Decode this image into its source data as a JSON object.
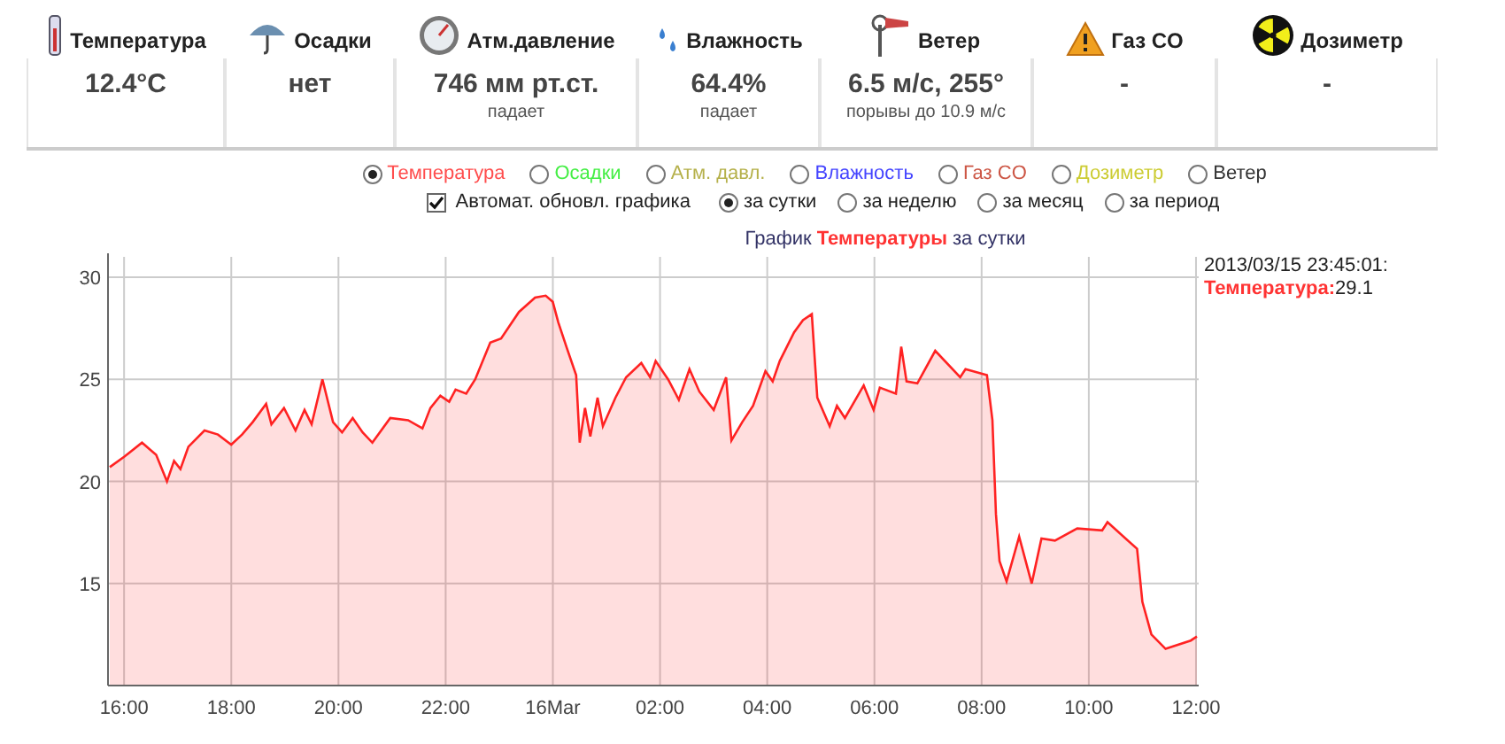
{
  "sensors": [
    {
      "kind": "thermometer",
      "label": "Температура",
      "value": "12.4°C"
    },
    {
      "kind": "umbrella",
      "label": "Осадки",
      "value": "нет"
    },
    {
      "kind": "gauge",
      "label": "Атм.давление",
      "value": "746 мм рт.ст.",
      "note": "падает"
    },
    {
      "kind": "drops",
      "label": "Влажность",
      "value": "64.4%",
      "note": "падает"
    },
    {
      "kind": "windsock",
      "label": "Ветер",
      "value": "6.5 м/с, 255°",
      "note": "порывы до 10.9 м/с"
    },
    {
      "kind": "warning",
      "label": "Газ CO",
      "value": "-"
    },
    {
      "kind": "radiation",
      "label": "Дозиметр",
      "value": "-"
    }
  ],
  "series_options": [
    {
      "label": "Температура",
      "color": "#ff4d4d",
      "selected": true
    },
    {
      "label": "Осадки",
      "color": "#44ee44",
      "selected": false
    },
    {
      "label": "Атм. давл.",
      "color": "#b5b04a",
      "selected": false
    },
    {
      "label": "Влажность",
      "color": "#4444ff",
      "selected": false
    },
    {
      "label": "Газ CO",
      "color": "#cc5544",
      "selected": false
    },
    {
      "label": "Дозиметр",
      "color": "#cccc33",
      "selected": false
    },
    {
      "label": "Ветер",
      "color": "#333333",
      "selected": false
    }
  ],
  "auto_update": {
    "label": "Автомат. обновл. графика",
    "checked": true
  },
  "periods": [
    {
      "label": "за сутки",
      "selected": true
    },
    {
      "label": "за неделю",
      "selected": false
    },
    {
      "label": "за месяц",
      "selected": false
    },
    {
      "label": "за период",
      "selected": false
    }
  ],
  "chart_heading": [
    {
      "text": "График",
      "color": "#333366"
    },
    {
      "text": "Температуры",
      "color": "#ff3333"
    },
    {
      "text": "за сутки",
      "color": "#333366"
    }
  ],
  "legend": {
    "timestamp": "2013/03/15 23:45:01:",
    "separator": ":",
    "value": "29.1"
  },
  "chart_data": {
    "type": "area",
    "grid": true,
    "xlim": [
      "2013-03-15T15:42",
      "2013-03-16T12:03"
    ],
    "ylim": [
      10,
      31
    ],
    "yticks": [
      15,
      20,
      25,
      30
    ],
    "xticks": [
      {
        "value": "2013-03-15T16:00",
        "label": "16:00"
      },
      {
        "value": "2013-03-15T18:00",
        "label": "18:00"
      },
      {
        "value": "2013-03-15T20:00",
        "label": "20:00"
      },
      {
        "value": "2013-03-15T22:00",
        "label": "22:00"
      },
      {
        "value": "2013-03-16T00:00",
        "label": "16Mar"
      },
      {
        "value": "2013-03-16T02:00",
        "label": "02:00"
      },
      {
        "value": "2013-03-16T04:00",
        "label": "04:00"
      },
      {
        "value": "2013-03-16T06:00",
        "label": "06:00"
      },
      {
        "value": "2013-03-16T08:00",
        "label": "08:00"
      },
      {
        "value": "2013-03-16T10:00",
        "label": "10:00"
      },
      {
        "value": "2013-03-16T12:00",
        "label": "12:00"
      }
    ],
    "x": [
      "2013-03-15T15:44",
      "2013-03-15T16:00",
      "2013-03-15T16:20",
      "2013-03-15T16:36",
      "2013-03-15T16:48",
      "2013-03-15T16:56",
      "2013-03-15T17:03",
      "2013-03-15T17:12",
      "2013-03-15T17:30",
      "2013-03-15T17:45",
      "2013-03-15T18:00",
      "2013-03-15T18:12",
      "2013-03-15T18:24",
      "2013-03-15T18:39",
      "2013-03-15T18:45",
      "2013-03-15T18:59",
      "2013-03-15T19:12",
      "2013-03-15T19:22",
      "2013-03-15T19:30",
      "2013-03-15T19:42",
      "2013-03-15T19:54",
      "2013-03-15T20:04",
      "2013-03-15T20:16",
      "2013-03-15T20:27",
      "2013-03-15T20:38",
      "2013-03-15T20:58",
      "2013-03-15T21:18",
      "2013-03-15T21:34",
      "2013-03-15T21:43",
      "2013-03-15T21:54",
      "2013-03-15T22:04",
      "2013-03-15T22:11",
      "2013-03-15T22:23",
      "2013-03-15T22:33",
      "2013-03-15T22:50",
      "2013-03-15T23:02",
      "2013-03-15T23:22",
      "2013-03-15T23:40",
      "2013-03-15T23:52",
      "2013-03-16T00:00",
      "2013-03-16T00:06",
      "2013-03-16T00:16",
      "2013-03-16T00:26",
      "2013-03-16T00:30",
      "2013-03-16T00:36",
      "2013-03-16T00:42",
      "2013-03-16T00:50",
      "2013-03-16T00:56",
      "2013-03-16T01:10",
      "2013-03-16T01:22",
      "2013-03-16T01:39",
      "2013-03-16T01:49",
      "2013-03-16T01:55",
      "2013-03-16T02:09",
      "2013-03-16T02:21",
      "2013-03-16T02:33",
      "2013-03-16T02:44",
      "2013-03-16T03:00",
      "2013-03-16T03:14",
      "2013-03-16T03:20",
      "2013-03-16T03:32",
      "2013-03-16T03:44",
      "2013-03-16T03:58",
      "2013-03-16T04:06",
      "2013-03-16T04:14",
      "2013-03-16T04:30",
      "2013-03-16T04:40",
      "2013-03-16T04:50",
      "2013-03-16T04:56",
      "2013-03-16T05:10",
      "2013-03-16T05:18",
      "2013-03-16T05:27",
      "2013-03-16T05:48",
      "2013-03-16T05:59",
      "2013-03-16T06:06",
      "2013-03-16T06:24",
      "2013-03-16T06:30",
      "2013-03-16T06:36",
      "2013-03-16T06:48",
      "2013-03-16T07:08",
      "2013-03-16T07:36",
      "2013-03-16T07:42",
      "2013-03-16T08:06",
      "2013-03-16T08:12",
      "2013-03-16T08:16",
      "2013-03-16T08:20",
      "2013-03-16T08:28",
      "2013-03-16T08:42",
      "2013-03-16T08:56",
      "2013-03-16T09:07",
      "2013-03-16T09:22",
      "2013-03-16T09:47",
      "2013-03-16T10:15",
      "2013-03-16T10:21",
      "2013-03-16T10:54",
      "2013-03-16T11:00",
      "2013-03-16T11:10",
      "2013-03-16T11:26",
      "2013-03-16T11:54",
      "2013-03-16T12:01"
    ],
    "series": [
      {
        "name": "Температура",
        "color": "#ff2222",
        "values": [
          20.7,
          21.2,
          21.9,
          21.3,
          20.0,
          21.0,
          20.6,
          21.7,
          22.5,
          22.3,
          21.8,
          22.3,
          22.9,
          23.8,
          22.8,
          23.6,
          22.5,
          23.5,
          22.8,
          25.0,
          22.9,
          22.4,
          23.1,
          22.4,
          21.9,
          23.1,
          23.0,
          22.6,
          23.6,
          24.2,
          23.9,
          24.5,
          24.3,
          25.0,
          26.8,
          27.0,
          28.3,
          29.0,
          29.1,
          28.8,
          27.8,
          26.5,
          25.2,
          21.9,
          23.6,
          22.2,
          24.1,
          22.7,
          24.1,
          25.1,
          25.8,
          25.1,
          25.9,
          25.0,
          24.0,
          25.5,
          24.4,
          23.5,
          25.1,
          22.0,
          22.9,
          23.7,
          25.4,
          24.9,
          25.9,
          27.3,
          27.9,
          28.2,
          24.1,
          22.7,
          23.7,
          23.1,
          24.7,
          23.5,
          24.6,
          24.3,
          26.6,
          24.9,
          24.8,
          26.4,
          25.1,
          25.5,
          25.2,
          23.0,
          18.4,
          16.1,
          15.1,
          17.3,
          15.0,
          17.2,
          17.1,
          17.7,
          17.6,
          18.0,
          16.7,
          14.1,
          12.5,
          11.8,
          12.2,
          12.4
        ]
      }
    ]
  }
}
